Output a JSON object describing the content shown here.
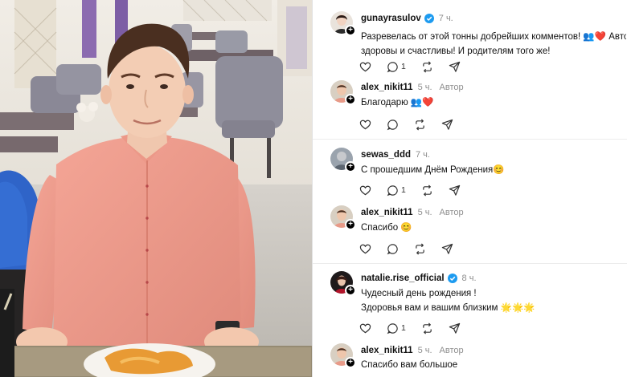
{
  "thread": {
    "comments": [
      {
        "username": "gunayrasulov",
        "verified": true,
        "time": "7 ч.",
        "author_label": "",
        "lines": [
          "Разревелась от этой тонны добрейших комментов! 👥❤️ Автор,",
          "здоровы и счастливы! И родителям того же!"
        ],
        "reply_count": "1"
      },
      {
        "username": "alex_nikit11",
        "verified": false,
        "time": "5 ч.",
        "author_label": "Автор",
        "lines": [
          "Благодарю 👥❤️"
        ],
        "reply_count": ""
      },
      {
        "username": "sewas_ddd",
        "verified": false,
        "time": "7 ч.",
        "author_label": "",
        "lines": [
          "С прошедшим Днём Рождения😊"
        ],
        "reply_count": "1"
      },
      {
        "username": "alex_nikit11",
        "verified": false,
        "time": "5 ч.",
        "author_label": "Автор",
        "lines": [
          "Спасибо 😊"
        ],
        "reply_count": ""
      },
      {
        "username": "natalie.rise_official",
        "verified": true,
        "time": "8 ч.",
        "author_label": "",
        "lines": [
          "Чудесный день рождения !",
          "Здоровья вам и вашим близким 🌟🌟🌟"
        ],
        "reply_count": "1"
      },
      {
        "username": "alex_nikit11",
        "verified": false,
        "time": "5 ч.",
        "author_label": "Автор",
        "lines": [
          "Спасибо вам большое"
        ],
        "reply_count": ""
      }
    ]
  },
  "icons": {
    "like": "heart-icon",
    "reply": "comment-bubble-icon",
    "repost": "repost-icon",
    "share": "share-icon",
    "verified": "verified-badge-icon",
    "follow": "plus-icon"
  },
  "colors": {
    "verified": "#1d9bf0",
    "muted": "#8e8e8e",
    "heart": "#e0245e"
  }
}
